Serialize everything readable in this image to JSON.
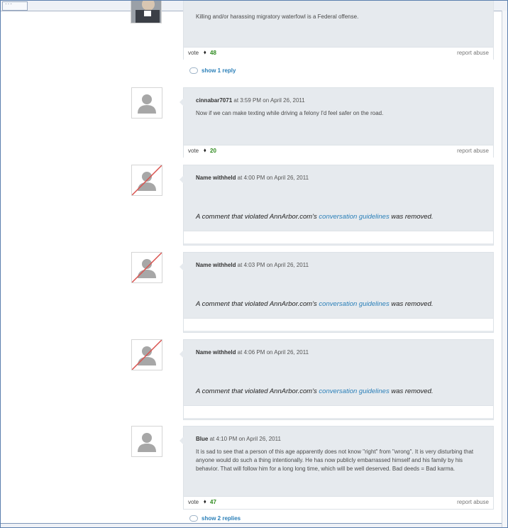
{
  "window": {
    "tab_glyph": "···"
  },
  "comments": [
    {
      "body": "Killing and/or harassing migratory waterfowl is a Federal offense.",
      "vote_label": "vote",
      "vote_arrow": "⬧",
      "vote_count": "48",
      "report_label": "report abuse",
      "replies_label": "show 1 reply"
    },
    {
      "author": "cinnabar7071",
      "meta": " at 3:59 PM on April 26, 2011",
      "body": "Now if we can make texting while driving a felony I'd feel safer on the road.",
      "vote_label": "vote",
      "vote_arrow": "⬧",
      "vote_count": "20",
      "report_label": "report abuse"
    },
    {
      "author": "Name withheld",
      "meta": " at 4:00 PM on April 26, 2011",
      "removed_prefix": "A comment that violated AnnArbor.com's ",
      "removed_link": "conversation guidelines",
      "removed_suffix": " was removed."
    },
    {
      "author": "Name withheld",
      "meta": " at 4:03 PM on April 26, 2011",
      "removed_prefix": "A comment that violated AnnArbor.com's ",
      "removed_link": "conversation guidelines",
      "removed_suffix": " was removed."
    },
    {
      "author": "Name withheld",
      "meta": " at 4:06 PM on April 26, 2011",
      "removed_prefix": "A comment that violated AnnArbor.com's ",
      "removed_link": "conversation guidelines",
      "removed_suffix": " was removed."
    },
    {
      "author": "Blue",
      "meta": " at 4:10 PM on April 26, 2011",
      "body": "It is sad to see that a person of this age apparently does not know \"right\" from \"wrong\". It is very disturbing that anyone would do such a thing intentionally. He has now publicly embarrassed himself and his family by his behavior. That will follow him for a long long time, which will be well deserved. Bad deeds = Bad karma.",
      "vote_label": "vote",
      "vote_arrow": "⬧",
      "vote_count": "47",
      "report_label": "report abuse",
      "replies_label": "show 2 replies"
    }
  ],
  "colors": {
    "comment_bg": "#e6eaee",
    "link": "#2a7fb8",
    "vote_count": "#2e8a1e",
    "removed_slash": "#d9534f"
  }
}
